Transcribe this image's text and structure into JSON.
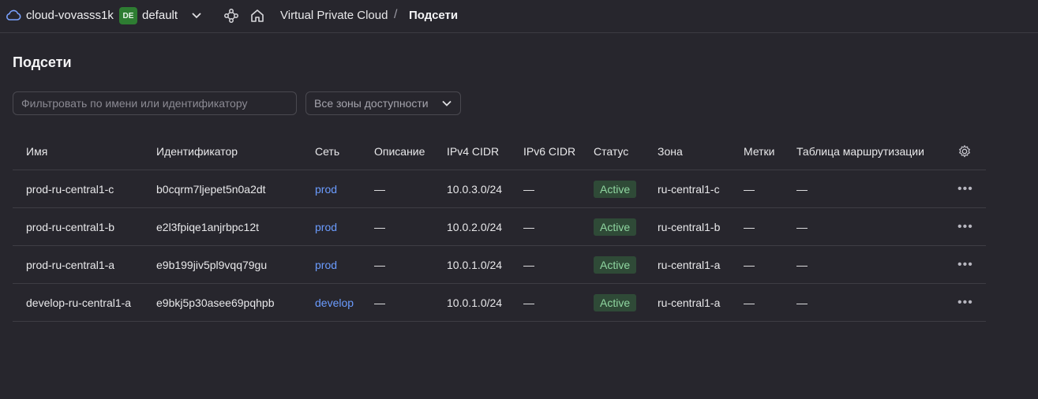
{
  "header": {
    "cloud_name": "cloud-vovasss1k",
    "folder_badge": "DE",
    "folder_name": "default",
    "breadcrumb_service": "Virtual Private Cloud",
    "breadcrumb_separator": "/",
    "breadcrumb_current": "Подсети"
  },
  "page": {
    "title": "Подсети",
    "filter_placeholder": "Фильтровать по имени или идентификатору",
    "zone_select_value": "Все зоны доступности"
  },
  "table": {
    "columns": [
      "Имя",
      "Идентификатор",
      "Сеть",
      "Описание",
      "IPv4 CIDR",
      "IPv6 CIDR",
      "Статус",
      "Зона",
      "Метки",
      "Таблица маршрутизации"
    ],
    "rows": [
      {
        "name": "prod-ru-central1-c",
        "id": "b0cqrm7ljepet5n0a2dt",
        "network": "prod",
        "description": "—",
        "ipv4": "10.0.3.0/24",
        "ipv6": "—",
        "status": "Active",
        "zone": "ru-central1-c",
        "labels": "—",
        "route_table": "—"
      },
      {
        "name": "prod-ru-central1-b",
        "id": "e2l3fpiqe1anjrbpc12t",
        "network": "prod",
        "description": "—",
        "ipv4": "10.0.2.0/24",
        "ipv6": "—",
        "status": "Active",
        "zone": "ru-central1-b",
        "labels": "—",
        "route_table": "—"
      },
      {
        "name": "prod-ru-central1-a",
        "id": "e9b199jiv5pl9vqq79gu",
        "network": "prod",
        "description": "—",
        "ipv4": "10.0.1.0/24",
        "ipv6": "—",
        "status": "Active",
        "zone": "ru-central1-a",
        "labels": "—",
        "route_table": "—"
      },
      {
        "name": "develop-ru-central1-a",
        "id": "e9bkj5p30asee69pqhpb",
        "network": "develop",
        "description": "—",
        "ipv4": "10.0.1.0/24",
        "ipv6": "—",
        "status": "Active",
        "zone": "ru-central1-a",
        "labels": "—",
        "route_table": "—"
      }
    ],
    "row_menu_label": "•••"
  },
  "icons": {
    "cloud": "cloud-icon",
    "chevron": "chevron-down-icon",
    "nodes": "nodes-icon",
    "home": "home-icon",
    "gear": "gear-icon",
    "more": "more-icon"
  },
  "colors": {
    "background": "#27262d",
    "link": "#6b9cff",
    "status_bg": "#2f4a37",
    "status_text": "#8fd6a0",
    "folder_badge": "#2e7d32"
  }
}
